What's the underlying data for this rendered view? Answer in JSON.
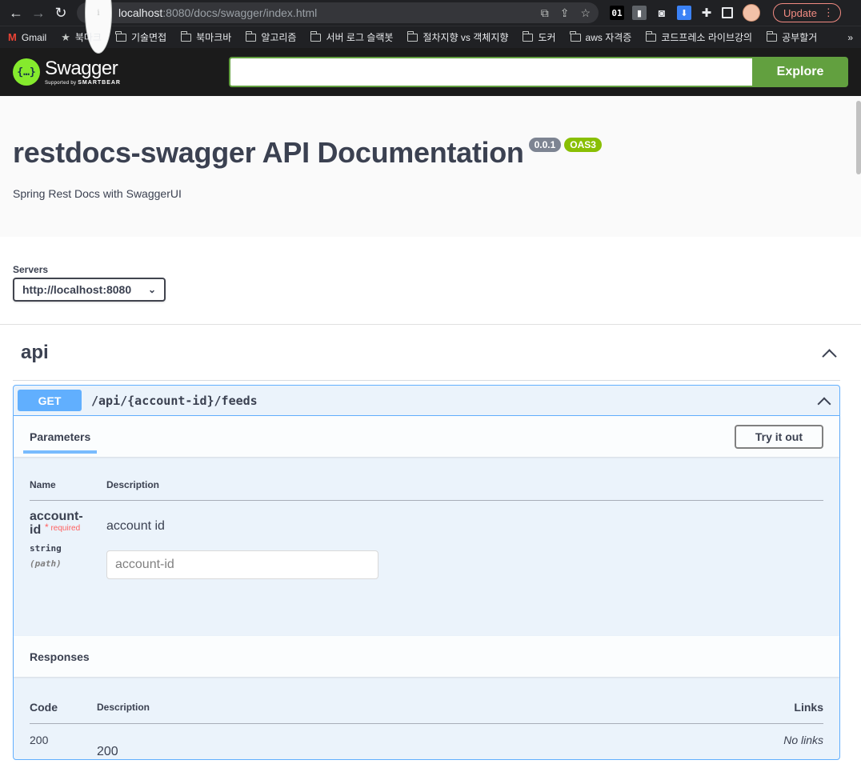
{
  "browser": {
    "url_host": "localhost",
    "url_path": ":8080/docs/swagger/index.html",
    "update_label": "Update",
    "ext_01_label": "01",
    "bookmarks": [
      {
        "label": "Gmail",
        "icon": "gmail-icon"
      },
      {
        "label": "북마크",
        "icon": "star-icon"
      },
      {
        "label": "기술면접",
        "icon": "folder-icon"
      },
      {
        "label": "북마크바",
        "icon": "folder-icon"
      },
      {
        "label": "알고리즘",
        "icon": "folder-icon"
      },
      {
        "label": "서버 로그 슬랙봇",
        "icon": "folder-icon"
      },
      {
        "label": "절차지향 vs 객체지향",
        "icon": "folder-icon"
      },
      {
        "label": "도커",
        "icon": "folder-icon"
      },
      {
        "label": "aws 자격증",
        "icon": "folder-icon"
      },
      {
        "label": "코드프레소 라이브강의",
        "icon": "folder-icon"
      },
      {
        "label": "공부할거",
        "icon": "folder-icon"
      }
    ],
    "bookmarks_more": "»"
  },
  "topbar": {
    "logo_text": "Swagger",
    "logo_sub_prefix": "Supported by",
    "logo_sub_brand": "SMARTBEAR",
    "logo_glyph": "{…}",
    "explore_input_value": "",
    "explore_label": "Explore"
  },
  "info": {
    "title": "restdocs-swagger API Documentation",
    "version": "0.0.1",
    "oas": "OAS3",
    "description": "Spring Rest Docs with SwaggerUI"
  },
  "servers": {
    "label": "Servers",
    "selected": "http://localhost:8080"
  },
  "tag": {
    "name": "api"
  },
  "operation": {
    "method": "GET",
    "path": "/api/{account-id}/feeds",
    "parameters_tab": "Parameters",
    "try_label": "Try it out",
    "param_headers": {
      "name": "Name",
      "description": "Description"
    },
    "params": [
      {
        "name_line1": "account-",
        "name_line2": "id",
        "required_label": "required",
        "type": "string",
        "in": "(path)",
        "description": "account id",
        "placeholder": "account-id"
      }
    ],
    "responses_label": "Responses",
    "resp_headers": {
      "code": "Code",
      "description": "Description",
      "links": "Links"
    },
    "responses": [
      {
        "code": "200",
        "description": "200",
        "links": "No links"
      }
    ]
  },
  "colors": {
    "get_blue": "#61affe",
    "swagger_green": "#62a03f",
    "oas_green": "#89bf04",
    "version_gray": "#7d8492"
  }
}
